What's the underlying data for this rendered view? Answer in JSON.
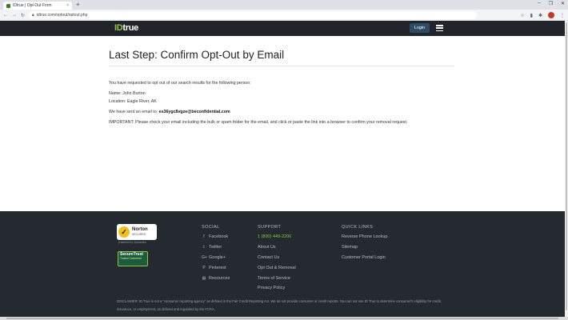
{
  "browser": {
    "tab_title": "IDtrue | Opt-Out Form",
    "tab_close": "×",
    "new_tab": "+",
    "url": "idtrue.com/optout/optout.php",
    "win_minimize": "‒",
    "win_restore": "❐",
    "win_close": "✕"
  },
  "navbar": {
    "logo_id": "ID",
    "logo_true": "true",
    "login_label": "Login"
  },
  "main": {
    "title": "Last Step: Confirm Opt-Out by Email",
    "intro": "You have requested to opt out of our search results for the following person:",
    "name_line": "Name: John Burton",
    "location_line": "Location: Eagle River, AK",
    "email_prefix": "We have sent an email to: ",
    "email": "es36ygc8vgze@beconfidential.com",
    "important": "IMPORTANT: Please check your email including the bulk or spam folder for the email, and click or paste the link into a browser to confirm your removal request."
  },
  "footer": {
    "norton_title": "Norton",
    "norton_sub": "SECURED",
    "norton_powered": "powered by Symantec",
    "securetrust_title": "SecureTrust",
    "securetrust_sub": "Trusted Commerce",
    "social_head": "SOCIAL",
    "social": [
      {
        "label": "Facebook",
        "icon": "f"
      },
      {
        "label": "Twitter",
        "icon": "t"
      },
      {
        "label": "Google+",
        "icon": "G+"
      },
      {
        "label": "Pinterest",
        "icon": "P"
      },
      {
        "label": "Resources",
        "icon": "▤"
      }
    ],
    "support_head": "SUPPORT",
    "support": [
      "1 (800) 449-2206",
      "About Us",
      "Contact Us",
      "Opt Out & Removal",
      "Terms of Service",
      "Privacy Policy"
    ],
    "quick_head": "QUICK LINKS",
    "quick": [
      "Reverse Phone Lookup",
      "Sitemap",
      "Customer Portal Login"
    ],
    "disclaimer": "DISCLAIMER: ID True is not a \"consumer reporting agency\" as defined in the Fair Credit Reporting Act. We do not provide consumer or credit reports. You can not use ID True to determine consumer's eligibility for credit, insurance, or employment, as defined and regulated by the FCRA."
  },
  "colors": {
    "brand_green": "#8cc63f",
    "navbar_bg": "#212529",
    "footer_bg": "#252a31",
    "login_bg": "#2d4a66"
  }
}
